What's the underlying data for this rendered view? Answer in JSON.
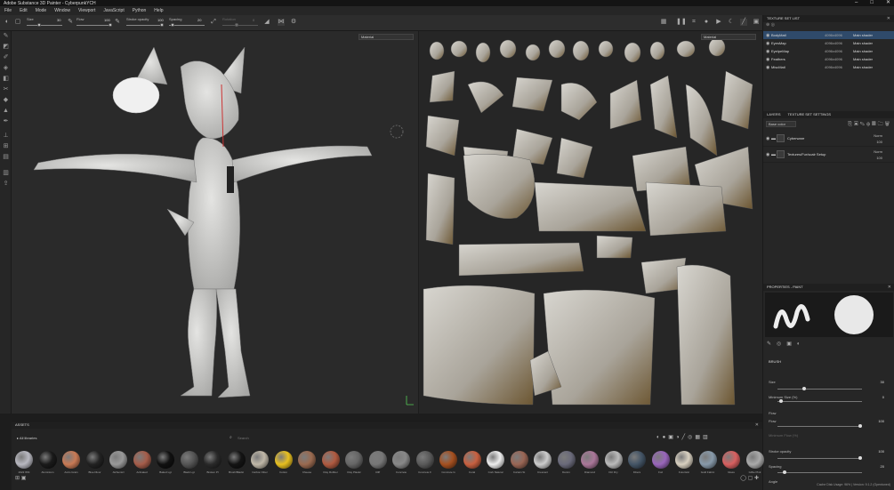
{
  "app": {
    "title": "Adobe Substance 3D Painter - CyberpunkYCH"
  },
  "window": {
    "minimize": "–",
    "maximize": "□",
    "close": "✕"
  },
  "menu": [
    "File",
    "Edit",
    "Mode",
    "Window",
    "Viewport",
    "JavaScript",
    "Python",
    "Help"
  ],
  "toolbar": {
    "size_label": "Size",
    "size_value": "30",
    "flow_label": "Flow",
    "flow_value": "100",
    "stroke_label": "Stroke opacity",
    "stroke_value": "100",
    "spacing_label": "Spacing",
    "spacing_value": "20",
    "rotation_label": "Rotation",
    "rotation_value": "0"
  },
  "viewports": {
    "left_mode": "Material",
    "right_mode": "Material"
  },
  "texture_sets": {
    "title": "TEXTURE SET LIST",
    "rows": [
      {
        "name": "BodyMatl",
        "res": "4096x4096",
        "shader": "Main shader"
      },
      {
        "name": "EyesMap",
        "res": "4096x4096",
        "shader": "Main shader"
      },
      {
        "name": "EyelpeMap",
        "res": "4096x4096",
        "shader": "Main shader"
      },
      {
        "name": "Feathers",
        "res": "4096x4096",
        "shader": "Main shader"
      },
      {
        "name": "MiscMatl",
        "res": "4096x4096",
        "shader": "Main shader"
      }
    ]
  },
  "layers": {
    "tab1": "LAYERS",
    "tab2": "TEXTURE SET SETTINGS",
    "channel": "Base color",
    "rows": [
      {
        "name": "Cyberware",
        "blend": "Norm",
        "opacity": "100"
      },
      {
        "name": "Textures/Fur/scalr Setup",
        "blend": "Norm",
        "opacity": "100"
      }
    ]
  },
  "properties": {
    "title": "PROPERTIES - PAINT",
    "section": "BRUSH",
    "size_label": "Size",
    "size_value": "30",
    "minsize_label": "Minimum Size (%)",
    "minsize_value": "0",
    "flow_header": "Flow",
    "flow_label": "Flow",
    "flow_value": "100",
    "minflow_label": "Minimum Flow (%)",
    "stroke_label": "Stroke opacity",
    "stroke_value": "100",
    "spacing_label": "Spacing",
    "spacing_value": "20",
    "angle_label": "Angle"
  },
  "assets": {
    "title": "ASSETS",
    "library": "All libraries",
    "search_placeholder": "Search",
    "items": [
      "2022 Whl",
      "Aluminium",
      "Astro Grain",
      "Blue Dloor",
      "Alchemicl",
      "Activated",
      "Baked Lgt",
      "Black Lgt",
      "Broken Pl",
      "Brush/Blackt",
      "Carbon Fiber",
      "Cotton",
      "Cheese",
      "Clay Rubber",
      "Clay Plastic",
      "Cliff",
      "Concrete",
      "Concrete F",
      "Concrete G",
      "Coral",
      "Cork Natural",
      "Curtain St",
      "Crescent",
      "Denim",
      "Diamond",
      "Dirt Dry",
      "Fibers",
      "Foil",
      "Futuristic",
      "Gold Fabric",
      "Glass",
      "Giftie Pink"
    ]
  },
  "status": {
    "text": "Cache Disk Usage: 96% | Version: 9.1.2 (Opentuned)"
  }
}
